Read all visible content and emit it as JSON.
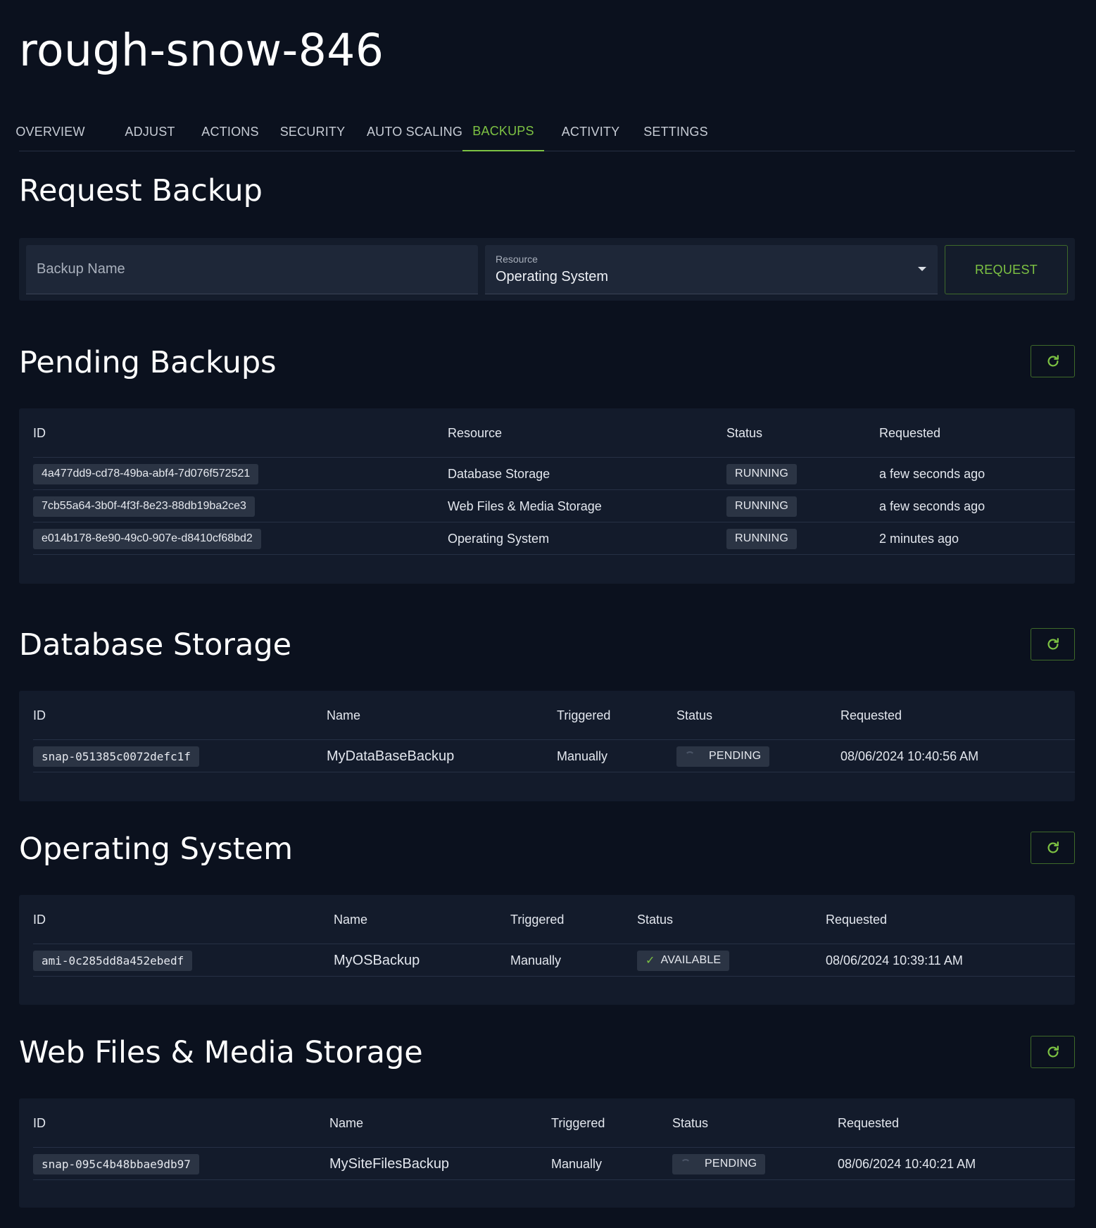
{
  "title": "rough-snow-846",
  "tabs": [
    "OVERVIEW",
    "ADJUST",
    "ACTIONS",
    "SECURITY",
    "AUTO SCALING",
    "BACKUPS",
    "ACTIVITY",
    "SETTINGS"
  ],
  "active_tab": "BACKUPS",
  "request": {
    "heading": "Request Backup",
    "name_placeholder": "Backup Name",
    "resource_label": "Resource",
    "resource_value": "Operating System",
    "button": "REQUEST"
  },
  "pending": {
    "heading": "Pending Backups",
    "headers": [
      "ID",
      "Resource",
      "Status",
      "Requested"
    ],
    "rows": [
      {
        "id": "4a477dd9-cd78-49ba-abf4-7d076f572521",
        "resource": "Database Storage",
        "status": "RUNNING",
        "requested": "a few seconds ago"
      },
      {
        "id": "7cb55a64-3b0f-4f3f-8e23-88db19ba2ce3",
        "resource": "Web Files & Media Storage",
        "status": "RUNNING",
        "requested": "a few seconds ago"
      },
      {
        "id": "e014b178-8e90-49c0-907e-d8410cf68bd2",
        "resource": "Operating System",
        "status": "RUNNING",
        "requested": "2 minutes ago"
      }
    ]
  },
  "database": {
    "heading": "Database Storage",
    "headers": [
      "ID",
      "Name",
      "Triggered",
      "Status",
      "Requested"
    ],
    "rows": [
      {
        "id": "snap-051385c0072defc1f",
        "name": "MyDataBaseBackup",
        "triggered": "Manually",
        "status": "PENDING",
        "requested": "08/06/2024 10:40:56 AM"
      }
    ]
  },
  "os": {
    "heading": "Operating System",
    "headers": [
      "ID",
      "Name",
      "Triggered",
      "Status",
      "Requested"
    ],
    "rows": [
      {
        "id": "ami-0c285dd8a452ebedf",
        "name": "MyOSBackup",
        "triggered": "Manually",
        "status": "AVAILABLE",
        "requested": "08/06/2024 10:39:11 AM"
      }
    ]
  },
  "web": {
    "heading": "Web Files & Media Storage",
    "headers": [
      "ID",
      "Name",
      "Triggered",
      "Status",
      "Requested"
    ],
    "rows": [
      {
        "id": "snap-095c4b48bbae9db97",
        "name": "MySiteFilesBackup",
        "triggered": "Manually",
        "status": "PENDING",
        "requested": "08/06/2024 10:40:21 AM"
      }
    ]
  },
  "icons": {
    "refresh": "refresh-icon",
    "check": "check-icon",
    "spinner": "spinner-icon",
    "caret": "caret-down-icon"
  },
  "colors": {
    "accent": "#7dc243",
    "background": "#0b111e",
    "card": "#131b2b"
  }
}
